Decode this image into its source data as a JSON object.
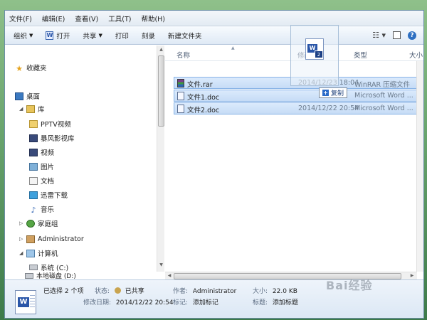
{
  "menu": {
    "items": [
      "文件(F)",
      "编辑(E)",
      "查看(V)",
      "工具(T)",
      "帮助(H)"
    ]
  },
  "toolbar": {
    "organize": "组织",
    "open": "打开",
    "share": "共享",
    "print": "打印",
    "burn": "刻录",
    "new_folder": "新建文件夹"
  },
  "sidebar": {
    "favorites": "收藏夹",
    "desktop": "桌面",
    "library": "库",
    "lib_items": [
      "PPTV视频",
      "暴风影视库",
      "视频",
      "图片",
      "文档",
      "迅雷下载",
      "音乐"
    ],
    "homegroup": "家庭组",
    "user": "Administrator",
    "computer": "计算机",
    "drive_c": "系统 (C:)",
    "drive_d": "本地磁盘 (D:)"
  },
  "columns": {
    "name": "名称",
    "modified": "修改",
    "type": "类型",
    "size": "大小"
  },
  "files": [
    {
      "name": "文件.rar",
      "date": "2014/12/23 18:04",
      "type": "WinRAR 压缩文件",
      "icon": "rar-icon"
    },
    {
      "name": "文件1.doc",
      "date": "",
      "type": "Microsoft Word ...",
      "icon": "word-doc-icon"
    },
    {
      "name": "文件2.doc",
      "date": "2014/12/22 20:54",
      "type": "Microsoft Word ...",
      "icon": "word-doc-icon"
    }
  ],
  "drag": {
    "count_badge": "2",
    "copy_label": "复制"
  },
  "details": {
    "selected": "已选择 2 个项",
    "status_k": "状态:",
    "status_v": "已共享",
    "author_k": "作者:",
    "author_v": "Administrator",
    "size_k": "大小:",
    "size_v": "22.0 KB",
    "modified_k": "修改日期:",
    "modified_v": "2014/12/22 20:54",
    "tags_k": "标记:",
    "tags_v": "添加标记",
    "title_k": "标题:",
    "title_v": "添加标题"
  },
  "watermark": "Bai经验",
  "colors": {
    "selection": "#c6dcf6",
    "selection_border": "#88b3e6",
    "toolbar": "#dfe9f5",
    "accent": "#2a56a8"
  }
}
